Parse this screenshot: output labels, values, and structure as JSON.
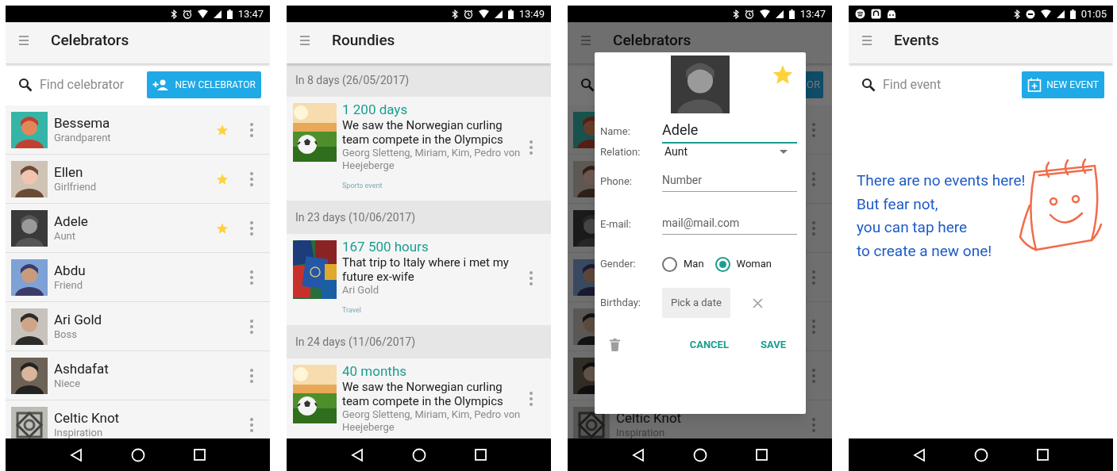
{
  "screens": [
    {
      "kind": "celebrators",
      "status_bar": {
        "time": "13:47"
      },
      "title": "Celebrators",
      "search": {
        "placeholder": "Find celebrator"
      },
      "new_button": "NEW CELEBRATOR",
      "contacts": [
        {
          "name": "Bessema",
          "relation": "Grandparent",
          "favorite": true
        },
        {
          "name": "Ellen",
          "relation": "Girlfriend",
          "favorite": true
        },
        {
          "name": "Adele",
          "relation": "Aunt",
          "favorite": true
        },
        {
          "name": "Abdu",
          "relation": "Friend",
          "favorite": false
        },
        {
          "name": "Ari Gold",
          "relation": "Boss",
          "favorite": false
        },
        {
          "name": "Ashdafat",
          "relation": "Niece",
          "favorite": false
        },
        {
          "name": "Celtic Knot",
          "relation": "Inspiration",
          "favorite": false
        }
      ]
    },
    {
      "kind": "roundies",
      "status_bar": {
        "time": "13:49"
      },
      "title": "Roundies",
      "groups": [
        {
          "heading": "In 8 days (26/05/2017)",
          "count": "1 200 days",
          "text": "We saw the Norwegian curling team compete in the Olympics",
          "people": "Georg Sletteng, Miriam, Kim, Pedro von Heejeberge",
          "category": "Sports event"
        },
        {
          "heading": "In 23 days (10/06/2017)",
          "count": "167 500 hours",
          "text": "That trip to Italy where i met my future ex-wife",
          "people": "Ari Gold",
          "category": "Travel"
        },
        {
          "heading": "In 24 days (11/06/2017)",
          "count": "40 months",
          "text": "We saw the Norwegian curling team compete in the Olympics",
          "people": "Georg Sletteng, Miriam, Kim, Pedro von Heejeberge"
        }
      ]
    },
    {
      "kind": "dialog",
      "status_bar": {
        "time": "13:47"
      },
      "title": "Celebrators",
      "new_button": "OR",
      "contacts": [
        {
          "covered": true
        },
        {
          "covered": true
        },
        {
          "covered": true
        },
        {
          "covered": true
        },
        {
          "covered": true
        },
        {
          "covered": true
        },
        {
          "covered": false,
          "name": "Celtic Knot",
          "relation": "Inspiration"
        }
      ],
      "dialog": {
        "favorite": true,
        "name_label": "Name:",
        "name_value": "Adele",
        "relation_label": "Relation:",
        "relation_value": "Aunt",
        "phone_label": "Phone:",
        "phone_placeholder": "Number",
        "email_label": "E-mail:",
        "email_placeholder": "mail@mail.com",
        "gender_label": "Gender:",
        "genders": [
          {
            "label": "Man",
            "selected": false
          },
          {
            "label": "Woman",
            "selected": true
          }
        ],
        "birthday_label": "Birthday:",
        "birthday_button": "Pick a date",
        "buttons": [
          "CANCEL",
          "SAVE"
        ]
      }
    },
    {
      "kind": "events",
      "status_bar": {
        "time": "01:05"
      },
      "title": "Events",
      "search": {
        "placeholder": "Find event"
      },
      "new_button": "NEW EVENT",
      "empty_message": [
        "There are no events here!",
        "But fear not,",
        "you can tap here",
        "to create a new one!"
      ]
    }
  ]
}
